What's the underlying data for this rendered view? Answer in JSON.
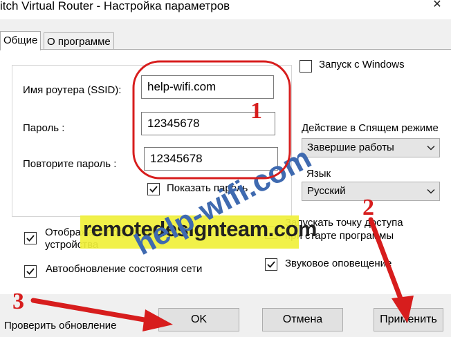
{
  "window": {
    "title": "itch Virtual Router - Настройка параметров",
    "close_glyph": "✕"
  },
  "tabs": [
    {
      "label": "Общие",
      "active": true
    },
    {
      "label": "О программе",
      "active": false
    }
  ],
  "router": {
    "ssid_label": "Имя роутера (SSID):",
    "ssid_value": "help-wifi.com",
    "password_label": "Пароль :",
    "password_value": "12345678",
    "repeat_label": "Повторите пароль :",
    "repeat_value": "12345678",
    "show_password_label": "Показать пароль",
    "show_password_checked": true
  },
  "right": {
    "autostart_label": "Запуск с Windows",
    "autostart_checked": false,
    "sleep_action_label": "Действие в Спящем режиме",
    "sleep_action_value": "Завершие работы",
    "language_label": "Язык",
    "language_value": "Русский"
  },
  "options": {
    "display_devices_line1": "Отображать подключенные",
    "display_devices_line2": "устройства",
    "display_devices_checked": true,
    "autoupdate_label": "Автообновление состояния сети",
    "autoupdate_checked": true,
    "start_ap_line1": "Запускать точку доступа",
    "start_ap_line2": "при старте программы",
    "start_ap_checked": false,
    "sound_label": "Звуковое оповещение",
    "sound_checked": true
  },
  "footer": {
    "check_update_label": "Проверить обновление",
    "ok_label": "OK",
    "cancel_label": "Отмена",
    "apply_label": "Применить"
  },
  "annotations": {
    "marker_1": "1",
    "marker_2": "2",
    "marker_3": "3",
    "accent_color": "#d71d1d",
    "watermark_main": "remotedesignteam.com",
    "watermark_site": "help-wifi.com",
    "watermark_color": "#3f6ab0"
  }
}
